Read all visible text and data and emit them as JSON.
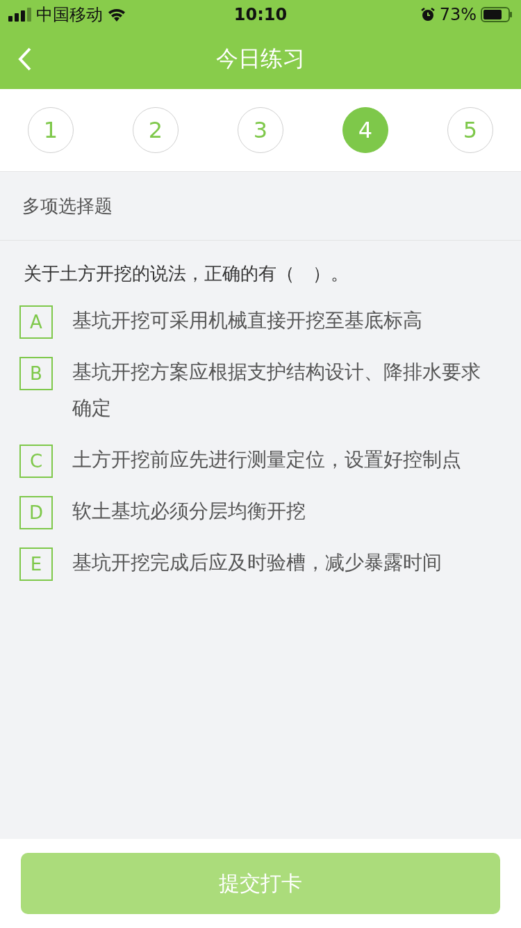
{
  "status_bar": {
    "carrier": "中国移动",
    "time": "10:10",
    "battery": "73%"
  },
  "nav": {
    "title": "今日练习"
  },
  "questions": [
    {
      "label": "1",
      "selected": false
    },
    {
      "label": "2",
      "selected": false
    },
    {
      "label": "3",
      "selected": false
    },
    {
      "label": "4",
      "selected": true
    },
    {
      "label": "5",
      "selected": false
    }
  ],
  "question_type": "多项选择题",
  "question": "关于土方开挖的说法，正确的有（　）。",
  "options": [
    {
      "letter": "A",
      "text": "基坑开挖可采用机械直接开挖至基底标高",
      "selected": false
    },
    {
      "letter": "B",
      "text": "基坑开挖方案应根据支护结构设计、降排水要求确定",
      "selected": false
    },
    {
      "letter": "C",
      "text": "土方开挖前应先进行测量定位，设置好控制点",
      "selected": false
    },
    {
      "letter": "D",
      "text": "软土基坑必须分层均衡开挖",
      "selected": false
    },
    {
      "letter": "E",
      "text": "基坑开挖完成后应及时验槽，减少暴露时间",
      "selected": false
    }
  ],
  "submit": {
    "label": "提交打卡",
    "disabled": true
  }
}
